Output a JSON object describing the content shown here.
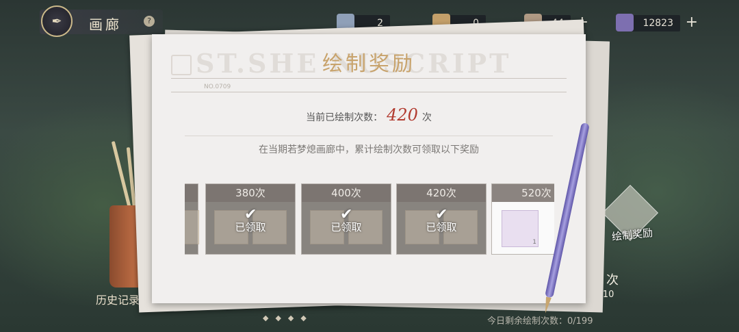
{
  "header": {
    "title": "画廊",
    "help": "?",
    "resources": [
      {
        "icon": "ticket-icon",
        "value": "2"
      },
      {
        "icon": "gift-box-icon",
        "value": "0"
      },
      {
        "icon": "pass-icon",
        "value": "44"
      },
      {
        "icon": "crystal-icon",
        "value": "12823"
      }
    ],
    "plus": "+"
  },
  "panel": {
    "title": "绘制奖励",
    "watermark": "ST.SHE    NUSCRIPT",
    "doc_no": "NO.0709",
    "count_label": "当前已绘制次数：",
    "count_value": "420",
    "count_unit": "次",
    "description": "在当期若梦熄画廊中，累计绘制次数可领取以下奖励"
  },
  "rewards": [
    {
      "label": "380次",
      "claimed": true,
      "claimed_text": "已领取"
    },
    {
      "label": "400次",
      "claimed": true,
      "claimed_text": "已领取"
    },
    {
      "label": "420次",
      "claimed": true,
      "claimed_text": "已领取"
    },
    {
      "label": "520次",
      "claimed": false,
      "item_count": "1"
    }
  ],
  "side": {
    "reward_button": "绘制奖励",
    "draw_times": "次",
    "draw_x10": "X10",
    "record_button": "历史记录",
    "remaining": "今日剩余绘制次数：0/199"
  },
  "colors": {
    "accent": "#c8a36c",
    "count": "#b23b30"
  }
}
